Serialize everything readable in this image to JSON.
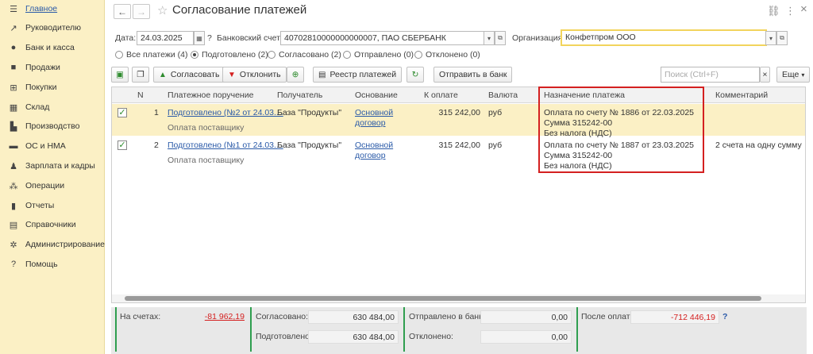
{
  "sidebar": {
    "items": [
      {
        "icon": "menu-icon",
        "glyph": "☰",
        "label": "Главное"
      },
      {
        "icon": "chart-trend-icon",
        "glyph": "↗",
        "label": "Руководителю"
      },
      {
        "icon": "bank-icon",
        "glyph": "●",
        "label": "Банк и касса"
      },
      {
        "icon": "shopping-bag-icon",
        "glyph": "■",
        "label": "Продажи"
      },
      {
        "icon": "cart-icon",
        "glyph": "⊞",
        "label": "Покупки"
      },
      {
        "icon": "warehouse-icon",
        "glyph": "▦",
        "label": "Склад"
      },
      {
        "icon": "factory-icon",
        "glyph": "▙",
        "label": "Производство"
      },
      {
        "icon": "truck-icon",
        "glyph": "▬",
        "label": "ОС и НМА"
      },
      {
        "icon": "person-icon",
        "glyph": "♟",
        "label": "Зарплата и кадры"
      },
      {
        "icon": "operations-icon",
        "glyph": "⁂",
        "label": "Операции"
      },
      {
        "icon": "bar-chart-icon",
        "glyph": "▮",
        "label": "Отчеты"
      },
      {
        "icon": "book-icon",
        "glyph": "▤",
        "label": "Справочники"
      },
      {
        "icon": "gear-icon",
        "glyph": "✲",
        "label": "Администрирование"
      },
      {
        "icon": "help-icon",
        "glyph": "?",
        "label": "Помощь"
      }
    ]
  },
  "header": {
    "back": "←",
    "forward": "→",
    "star": "☆",
    "title": "Согласование платежей",
    "link_icon": "⛓",
    "more_icon": "⋮",
    "close_icon": "×"
  },
  "filters": {
    "date_label": "Дата:",
    "date_value": "24.03.2025",
    "calendar_glyph": "▦",
    "help": "?",
    "account_label": "Банковский счет:",
    "account_value": "40702810000000000007, ПАО СБЕРБАНК",
    "org_label": "Организация:",
    "org_value": "Конфетпром ООО",
    "dropdown_glyph": "▾",
    "open_glyph": "⧉"
  },
  "statuses": [
    {
      "label": "Все платежи (4)",
      "selected": false
    },
    {
      "label": "Подготовлено (2)",
      "selected": true
    },
    {
      "label": "Согласовано (2)",
      "selected": false
    },
    {
      "label": "Отправлено (0)",
      "selected": false
    },
    {
      "label": "Отклонено (0)",
      "selected": false
    }
  ],
  "toolbar": {
    "approve": "Согласовать",
    "reject": "Отклонить",
    "registry": "Реестр платежей",
    "send": "Отправить в банк",
    "search_placeholder": "Поиск (Ctrl+F)",
    "clear": "×",
    "more": "Еще",
    "more_arrow": "▾"
  },
  "table": {
    "columns": [
      "N",
      "Платежное поручение",
      "Получатель",
      "Основание",
      "К оплате",
      "Валюта",
      "Назначение платежа",
      "Комментарий"
    ],
    "rows": [
      {
        "checked": true,
        "n": "1",
        "doc": "Подготовлено (№2 от 24.03....",
        "doc_sub": "Оплата поставщику",
        "recipient": "База \"Продукты\"",
        "basis_1": "Основной",
        "basis_2": "договор",
        "amount": "315 242,00",
        "currency": "руб",
        "purpose_1": "Оплата по счету № 1886 от 22.03.2025",
        "purpose_2": "Сумма 315242-00",
        "purpose_3": "Без налога (НДС)",
        "comment": ""
      },
      {
        "checked": true,
        "n": "2",
        "doc": "Подготовлено (№1 от 24.03....",
        "doc_sub": "Оплата поставщику",
        "recipient": "База \"Продукты\"",
        "basis_1": "Основной",
        "basis_2": "договор",
        "amount": "315 242,00",
        "currency": "руб",
        "purpose_1": "Оплата по счету № 1887 от 23.03.2025",
        "purpose_2": "Сумма 315242-00",
        "purpose_3": "Без налога (НДС)",
        "comment": "2 счета на одну сумму"
      }
    ]
  },
  "footer": {
    "on_accounts_label": "На счетах:",
    "on_accounts_value": "-81 962,19",
    "approved_label": "Согласовано:",
    "approved_value": "630 484,00",
    "prepared_label": "Подготовлено:",
    "prepared_value": "630 484,00",
    "sent_label": "Отправлено в банк:",
    "sent_value": "0,00",
    "rejected_label": "Отклонено:",
    "rejected_value": "0,00",
    "after_label": "После оплат:",
    "after_value": "-712 446,19",
    "help": "?"
  },
  "colors": {
    "sidebar_bg": "#fbf0c5",
    "selected_row": "#fbf0c5",
    "highlight_box": "#d42020",
    "negative": "#d42020",
    "divider": "#2f9e4f",
    "link": "#2a5aa8"
  }
}
